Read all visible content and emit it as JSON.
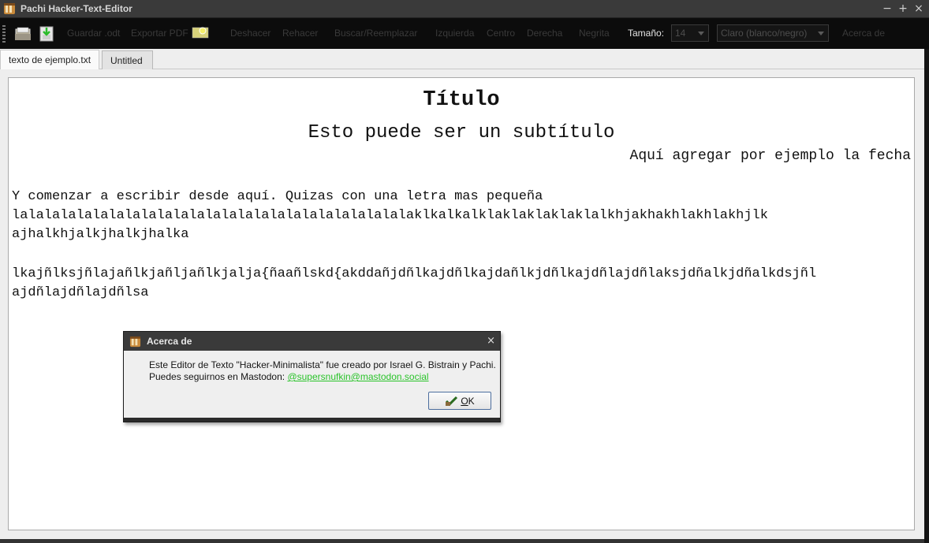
{
  "window": {
    "title": "Pachi Hacker-Text-Editor",
    "controls": [
      "−",
      "+",
      "×"
    ]
  },
  "toolbar": {
    "save_odt": "Guardar .odt",
    "export_pdf": "Exportar PDF",
    "undo": "Deshacer",
    "redo": "Rehacer",
    "search_replace": "Buscar/Reemplazar",
    "align_left": "Izquierda",
    "align_center": "Centro",
    "align_right": "Derecha",
    "bold": "Negrita",
    "size_label": "Tamaño:",
    "size_value": "14",
    "theme_value": "Claro (blanco/negro)",
    "about": "Acerca de"
  },
  "tabs": [
    {
      "label": "texto de ejemplo.txt",
      "active": true
    },
    {
      "label": "Untitled",
      "active": false
    }
  ],
  "document": {
    "title": "Título",
    "subtitle": "Esto puede ser un subtítulo",
    "date_line": "Aquí agregar por ejemplo la fecha",
    "body": [
      "Y comenzar a escribir desde aquí. Quizas con una letra mas pequeña",
      "lalalalalalalalalalalalalalalalalalalalalalalalalaklkalkalklaklaklaklaklalkhjakhakhlakhlakhjlk",
      "ajhalkhjalkjhalkjhalka",
      "",
      "lkajñlksjñlajañlkjañljañlkjalja{ñaañlskd{akddañjdñlkajdñlkajdañlkjdñlkajdñlajdñlaksjdñalkjdñalkdsjñl",
      "ajdñlajdñlajdñlsa"
    ]
  },
  "about_dialog": {
    "title": "Acerca de",
    "close": "×",
    "line1": "Este Editor de Texto \"Hacker-Minimalista\" fue creado por Israel G. Bistrain y Pachi.",
    "line2_prefix": "Puedes seguirnos en Mastodon: ",
    "link": "@supersnufkin@mastodon.social",
    "ok_underlined": "O",
    "ok_rest": "K"
  },
  "colors": {
    "link": "#2ac32a",
    "toolbar_bg": "#0c0c0c",
    "titlebar_bg": "#3a3a3a"
  }
}
